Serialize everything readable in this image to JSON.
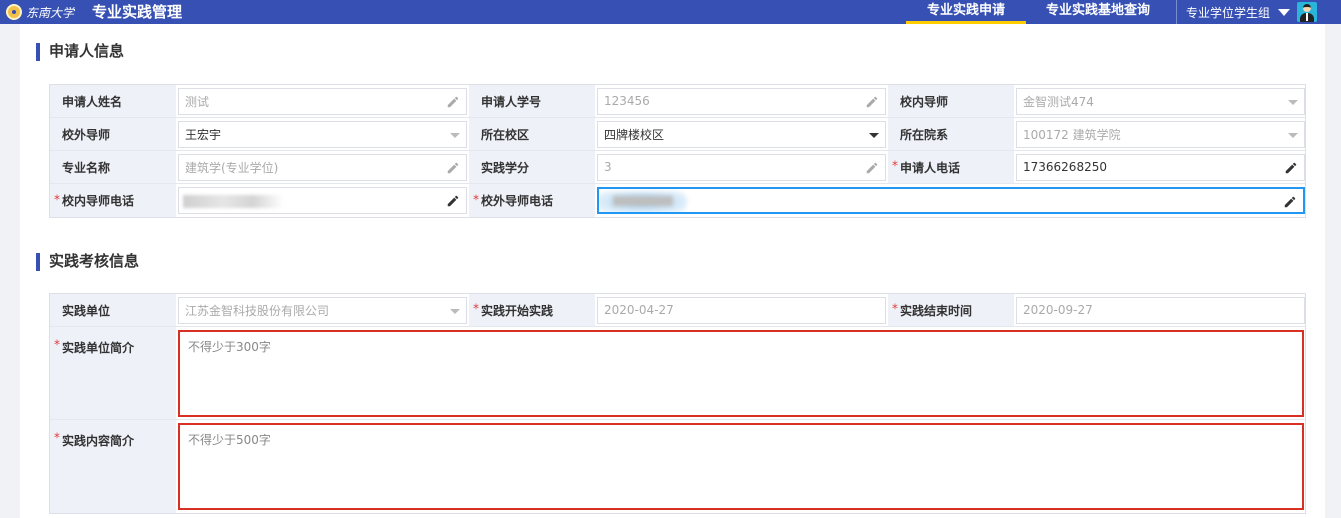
{
  "header": {
    "logo_text": "东南大学",
    "app_title": "专业实践管理",
    "nav": [
      {
        "label": "专业实践申请",
        "active": true
      },
      {
        "label": "专业实践基地查询",
        "active": false
      }
    ],
    "role": "专业学位学生组",
    "accent_color": "#3650b3",
    "active_underline_color": "#ffcc00"
  },
  "applicant": {
    "title": "申请人信息",
    "name_label": "申请人姓名",
    "name_value": "测试",
    "student_id_label": "申请人学号",
    "student_id_value": "123456",
    "internal_advisor_label": "校内导师",
    "internal_advisor_value": "金智测试474",
    "external_advisor_label": "校外导师",
    "external_advisor_value": "王宏宇",
    "campus_label": "所在校区",
    "campus_value": "四牌楼校区",
    "department_label": "所在院系",
    "department_value": "100172 建筑学院",
    "major_label": "专业名称",
    "major_value": "建筑学(专业学位)",
    "credits_label": "实践学分",
    "credits_value": "3",
    "phone_label": "申请人电话",
    "phone_value": "17366268250",
    "internal_phone_label": "校内导师电话",
    "external_phone_label": "校外导师电话"
  },
  "practice": {
    "title": "实践考核信息",
    "unit_label": "实践单位",
    "unit_value": "江苏金智科技股份有限公司",
    "start_label": "实践开始实践",
    "start_value": "2020-04-27",
    "end_label": "实践结束时间",
    "end_value": "2020-09-27",
    "unit_intro_label": "实践单位简介",
    "unit_intro_placeholder": "不得少于300字",
    "content_intro_label": "实践内容简介",
    "content_intro_placeholder": "不得少于500字"
  },
  "icons": {
    "edit": "pencil-icon",
    "dropdown": "caret-down-icon"
  },
  "colors": {
    "required_star": "#e53935",
    "error_border": "#d93025",
    "focus_border": "#2196f3",
    "label_bg": "#eef1f8"
  }
}
